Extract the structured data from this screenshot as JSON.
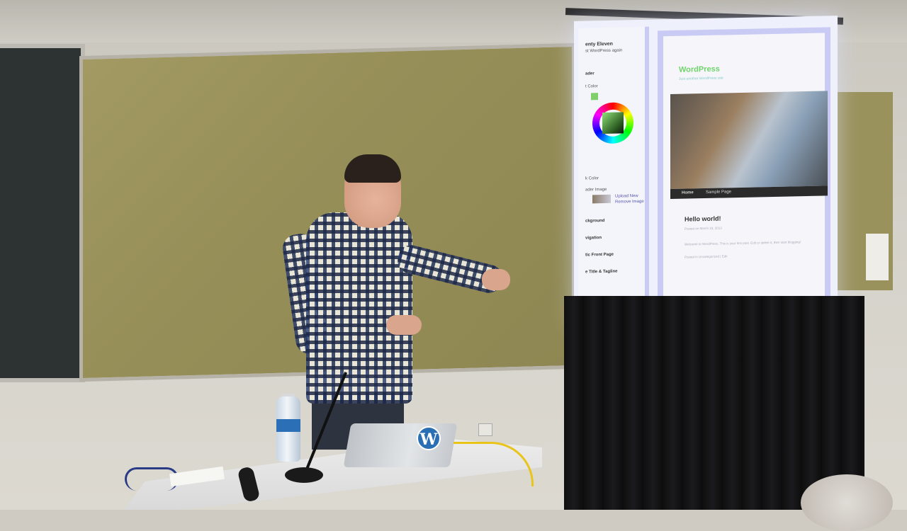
{
  "scene": {
    "description_type": "photo",
    "colors": {
      "corkboard": "#978f58",
      "chalkboard": "#2d3233",
      "curtain": "#0f0f10",
      "shirt_check_dark": "#283c6e",
      "site_title_green": "#6fd36a",
      "wordpress_blue": "#2a6eb3"
    }
  },
  "screen": {
    "customizer": {
      "theme_name": "enty Eleven",
      "theme_sub": "st WordPress again",
      "section_header": "ader",
      "color_label": "t Color",
      "link_label": "k Color",
      "header_image_label": "ader Image",
      "upload_new": "Upload New",
      "remove_image": "Remove Image",
      "background": "ckground",
      "navigation": "vigation",
      "static_front_page": "tic Front Page",
      "site_title_tagline": "e Title & Tagline"
    },
    "preview": {
      "site_title": "WordPress",
      "site_description": "Just another WordPress site",
      "nav": [
        "Home",
        "Sample Page"
      ],
      "post_title": "Hello world!",
      "post_meta": "Posted on March 18, 2013",
      "post_body": "Welcome to WordPress. This is your first post. Edit or delete it, then start blogging!",
      "post_footer": "Posted in Uncategorized | Edit"
    }
  },
  "laptop": {
    "logo_letter": "W",
    "apple_glyph": ""
  }
}
